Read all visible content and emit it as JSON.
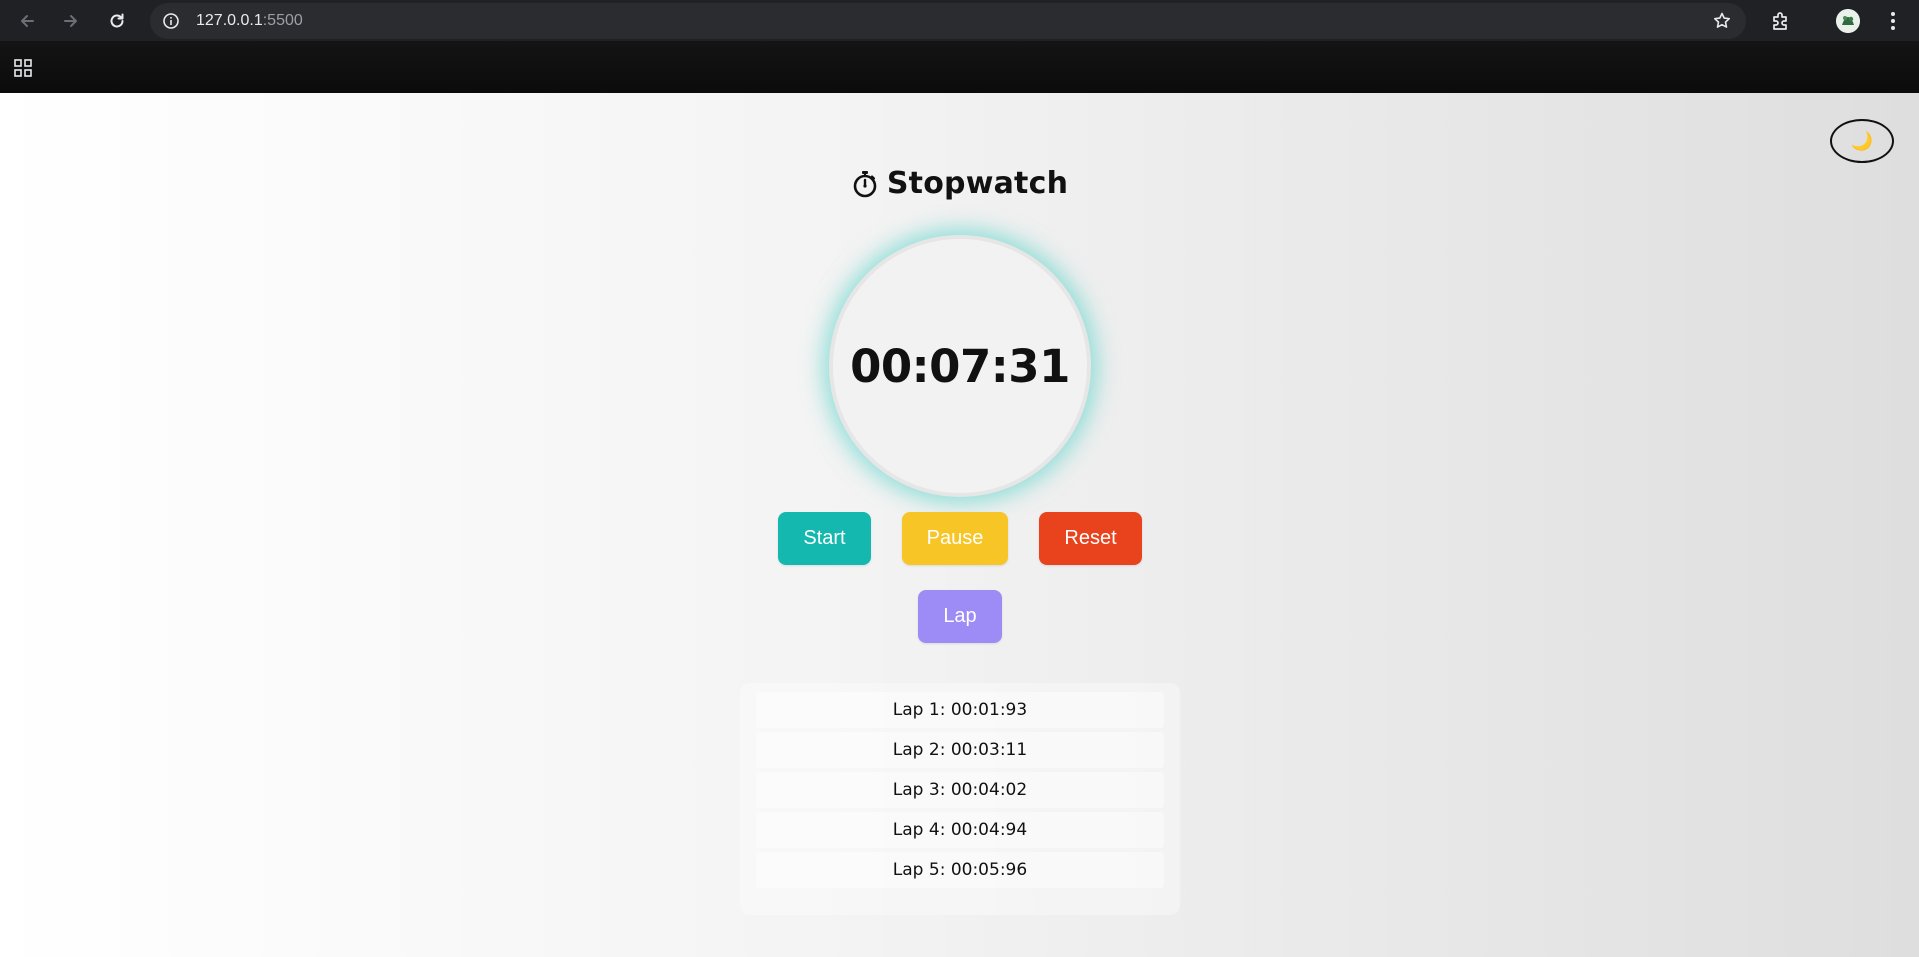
{
  "browser": {
    "url_host": "127.0.0.1",
    "url_port": ":5500"
  },
  "page": {
    "title": "Stopwatch",
    "time": "00:07:31",
    "theme_toggle_glyph": "🌙",
    "buttons": {
      "start": "Start",
      "pause": "Pause",
      "reset": "Reset",
      "lap": "Lap"
    },
    "laps": [
      "Lap 1: 00:01:93",
      "Lap 2: 00:03:11",
      "Lap 3: 00:04:02",
      "Lap 4: 00:04:94",
      "Lap 5: 00:05:96"
    ]
  },
  "colors": {
    "start": "#14b8ae",
    "pause": "#f7c526",
    "reset": "#e8431c",
    "lap": "#9d8cf5",
    "dial_glow": "#40cdc3"
  },
  "icons": {
    "back": "back-arrow-icon",
    "forward": "forward-arrow-icon",
    "reload": "reload-icon",
    "info": "info-icon",
    "star": "star-icon",
    "extensions": "puzzle-icon",
    "menu": "kebab-menu-icon",
    "apps": "apps-grid-icon",
    "title": "stopwatch-icon",
    "theme": "moon-icon"
  }
}
